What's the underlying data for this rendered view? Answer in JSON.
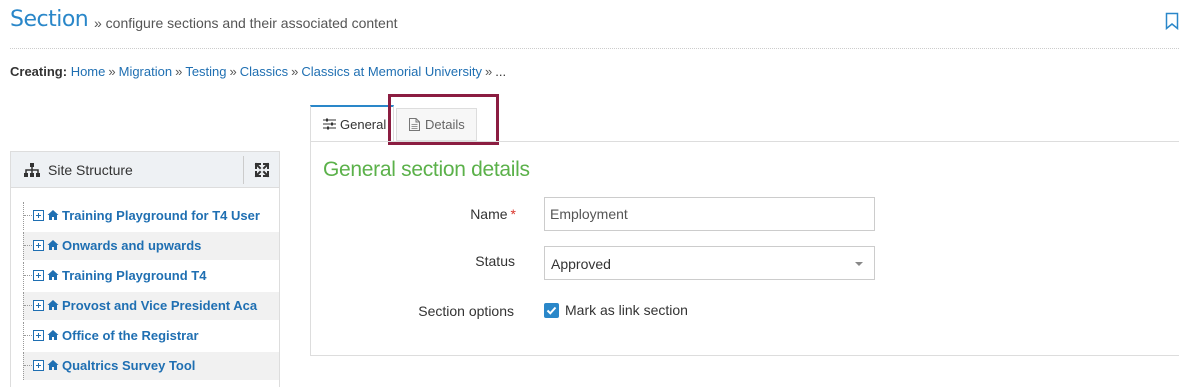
{
  "header": {
    "title": "Section",
    "subtitle": "» configure sections and their associated content"
  },
  "breadcrumb": {
    "label": "Creating:",
    "items": [
      "Home",
      "Migration",
      "Testing",
      "Classics",
      "Classics at Memorial University"
    ],
    "separator": "»",
    "trailing": "..."
  },
  "sidebar": {
    "title": "Site Structure",
    "items": [
      {
        "label": "Training Playground for T4 User"
      },
      {
        "label": "Onwards and upwards"
      },
      {
        "label": "Training Playground T4"
      },
      {
        "label": "Provost and Vice President Aca"
      },
      {
        "label": "Office of the Registrar"
      },
      {
        "label": "Qualtrics Survey Tool"
      }
    ]
  },
  "tabs": [
    {
      "label": "General",
      "active": true
    },
    {
      "label": "Details",
      "active": false
    }
  ],
  "form": {
    "heading": "General section details",
    "name_label": "Name",
    "required_marker": "*",
    "name_value": "Employment",
    "status_label": "Status",
    "status_value": "Approved",
    "options_label": "Section options",
    "link_section_label": "Mark as link section",
    "link_section_checked": true
  },
  "colors": {
    "title_blue": "#2a87c9",
    "link_blue": "#1f6fb2",
    "heading_green": "#5bb14a",
    "highlight": "#8b1d41"
  }
}
